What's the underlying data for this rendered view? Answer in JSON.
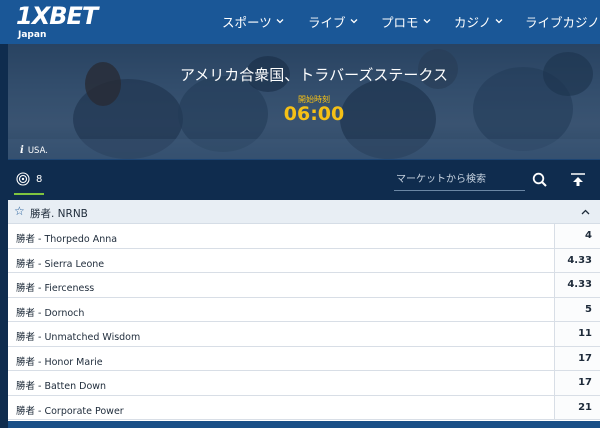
{
  "brand": {
    "logo_text": "1XBET",
    "region": "Japan"
  },
  "nav": {
    "items": [
      {
        "label": "スポーツ",
        "caret": "chevron-down"
      },
      {
        "label": "ライブ",
        "caret": "chevron-down"
      },
      {
        "label": "プロモ",
        "caret": "chevron-down"
      },
      {
        "label": "カジノ",
        "caret": "chevron-down"
      },
      {
        "label": "ライブカジノ"
      }
    ]
  },
  "event": {
    "title": "アメリカ合衆国、トラバーズステークス",
    "start_label": "開始時刻",
    "start_time": "06:00",
    "country": "USA."
  },
  "toolbar": {
    "markets_count": "8",
    "search_placeholder": "マーケットから検索",
    "icons": [
      "target-icon",
      "search-icon",
      "collapse-up-icon"
    ]
  },
  "market": {
    "title": "勝者. NRNB",
    "rows": [
      {
        "name": "勝者 - Thorpedo Anna",
        "odds": "4"
      },
      {
        "name": "勝者 - Sierra Leone",
        "odds": "4.33"
      },
      {
        "name": "勝者 - Fierceness",
        "odds": "4.33"
      },
      {
        "name": "勝者 - Dornoch",
        "odds": "5"
      },
      {
        "name": "勝者 - Unmatched Wisdom",
        "odds": "11"
      },
      {
        "name": "勝者 - Honor Marie",
        "odds": "17"
      },
      {
        "name": "勝者 - Batten Down",
        "odds": "17"
      },
      {
        "name": "勝者 - Corporate Power",
        "odds": "21"
      }
    ]
  },
  "colors": {
    "nav": "#1a5797",
    "dark": "#0f2c4e",
    "accent": "#f5c016",
    "green": "#7fc43f"
  }
}
